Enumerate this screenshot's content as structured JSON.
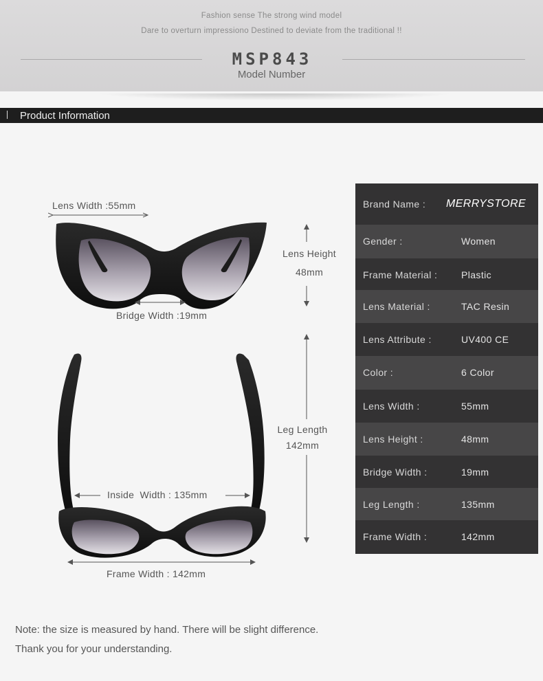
{
  "header": {
    "tagline_1": "Fashion sense The strong wind model",
    "tagline_2": "Dare to overturn impressiono Destined to deviate from the traditional !!",
    "model_code": "MSP843",
    "model_label": "Model Number"
  },
  "section": {
    "title": "Product Information"
  },
  "specs": [
    {
      "label": "Brand Name :",
      "value": "MERRYSTORE"
    },
    {
      "label": "Gender :",
      "value": "Women"
    },
    {
      "label": "Frame Material :",
      "value": "Plastic"
    },
    {
      "label": "Lens Material :",
      "value": "TAC Resin"
    },
    {
      "label": "Lens Attribute :",
      "value": "UV400 CE"
    },
    {
      "label": "Color :",
      "value": "6 Color"
    },
    {
      "label": "Lens Width :",
      "value": "55mm"
    },
    {
      "label": "Lens Height :",
      "value": "48mm"
    },
    {
      "label": "Bridge Width :",
      "value": "19mm"
    },
    {
      "label": "Leg Length :",
      "value": "135mm"
    },
    {
      "label": "Frame Width :",
      "value": "142mm"
    }
  ],
  "dimensions": {
    "lens_width": "Lens Width :55mm",
    "lens_height_label": "Lens Height",
    "lens_height_value": "48mm",
    "bridge_width": "Bridge Width :19mm",
    "leg_length_label": "Leg Length",
    "leg_length_value": "142mm",
    "inside_width": "Inside  Width : 135mm",
    "frame_width": "Frame Width : 142mm"
  },
  "note": {
    "line_1": "Note: the size is measured by hand. There will be slight difference.",
    "line_2": "Thank you for your understanding."
  },
  "colors": {
    "header_bg": "#d6d5d6",
    "section_bar": "#1e1e1e",
    "row_dark": "#333233",
    "row_light": "#474647",
    "page_bg": "#f5f5f5"
  }
}
